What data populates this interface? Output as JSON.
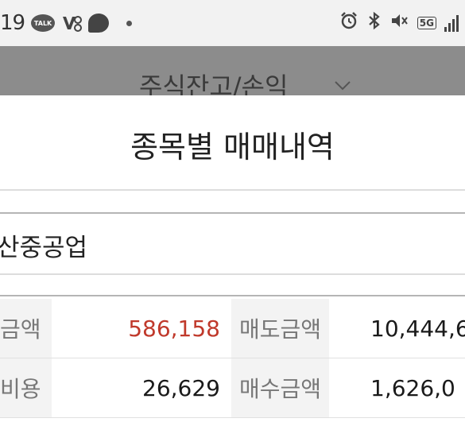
{
  "status_bar": {
    "time": "19",
    "talk_label": "TALK",
    "network": "5G"
  },
  "app_header": {
    "title": "주식잔고/손익"
  },
  "sheet": {
    "title": "종목별 매매내역",
    "stock_name": "산중공업"
  },
  "table": {
    "rows": [
      {
        "label1": "금액",
        "value1": "586,158",
        "label2": "매도금액",
        "value2": "10,444,6"
      },
      {
        "label1": "비용",
        "value1": "26,629",
        "label2": "매수금액",
        "value2": "1,626,0"
      }
    ]
  },
  "colors": {
    "positive_value": "#c0392b",
    "label_cell_bg": "#f3f3f3",
    "header_overlay": "#8c8c8c"
  }
}
